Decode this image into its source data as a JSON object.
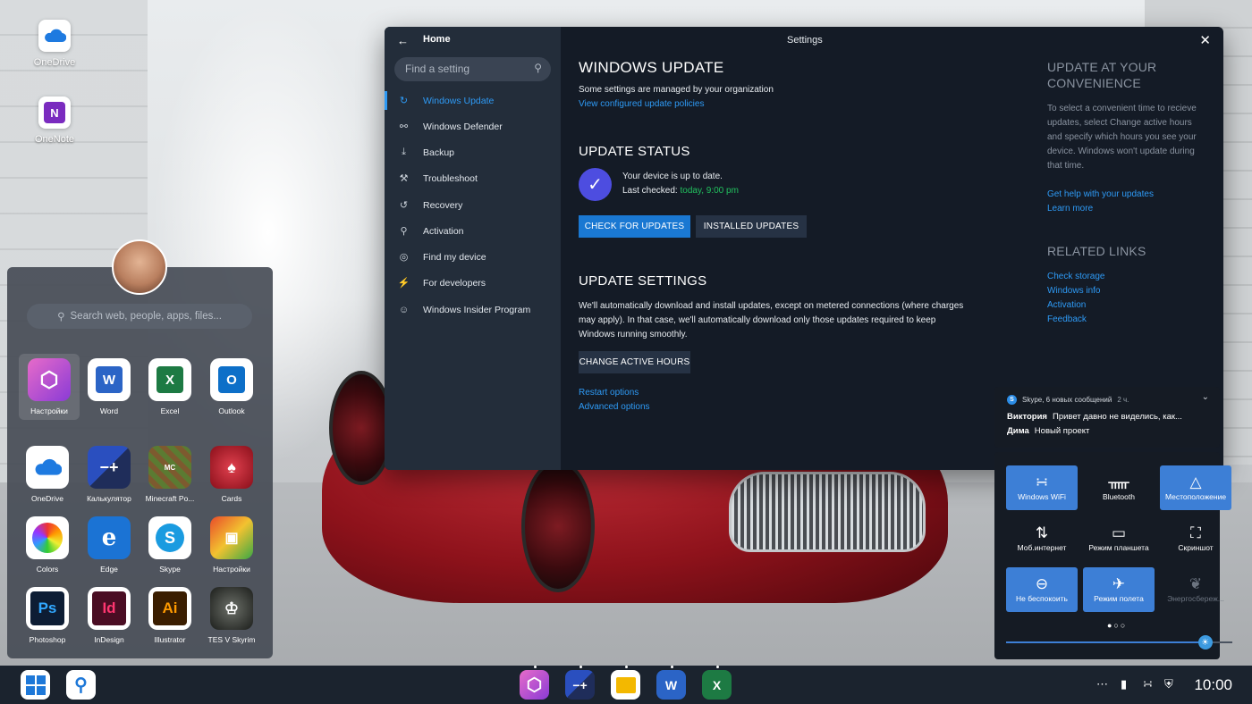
{
  "desktop": {
    "icons": [
      {
        "label": "OneDrive",
        "icon": "onedrive-icon"
      },
      {
        "label": "OneNote",
        "icon": "onenote-icon"
      }
    ]
  },
  "settings": {
    "home_label": "Home",
    "title": "Settings",
    "search_placeholder": "Find a setting",
    "nav": [
      {
        "label": "Windows Update",
        "icon": "refresh-icon",
        "active": true
      },
      {
        "label": "Windows Defender",
        "icon": "shield-icon"
      },
      {
        "label": "Backup",
        "icon": "backup-arrow-icon"
      },
      {
        "label": "Troubleshoot",
        "icon": "wrench-icon"
      },
      {
        "label": "Recovery",
        "icon": "history-icon"
      },
      {
        "label": "Activation",
        "icon": "key-icon"
      },
      {
        "label": "Find my device",
        "icon": "locate-icon"
      },
      {
        "label": "For developers",
        "icon": "developer-icon"
      },
      {
        "label": "Windows Insider Program",
        "icon": "insider-icon"
      }
    ],
    "main": {
      "heading": "WINDOWS UPDATE",
      "managed_note": "Some settings are managed by your organization",
      "policies_link": "View configured update policies",
      "status_heading": "UPDATE STATUS",
      "status_text": "Your device is up to date.",
      "last_checked_label": "Last checked:",
      "last_checked_value": "today, 9:00 pm",
      "check_button": "CHECK FOR UPDATES",
      "installed_button": "INSTALLED UPDATES",
      "settings_heading": "UPDATE SETTINGS",
      "settings_text": "We'll automatically download and install updates, except on metered connections (where charges may apply). In that case, we'll automatically download only those updates required to keep Windows running smoothly.",
      "active_hours_button": "CHANGE ACTIVE HOURS",
      "restart_link": "Restart options",
      "advanced_link": "Advanced options"
    },
    "side": {
      "convenience_heading": "UPDATE AT YOUR CONVENIENCE",
      "convenience_text": "To select a convenient time to recieve updates, select Change active hours and specify which hours you see your device. Windows won't update during that time.",
      "help_link": "Get help with your updates",
      "learn_link": "Learn more",
      "related_heading": "RELATED LINKS",
      "related_links": [
        "Check storage",
        "Windows info",
        "Activation",
        "Feedback"
      ]
    }
  },
  "start_menu": {
    "search_placeholder": "Search web, people, apps, files...",
    "apps": [
      {
        "label": "Настройки",
        "icon": "settings-hex-icon",
        "color": "#c13fa4"
      },
      {
        "label": "Word",
        "icon": "word-icon",
        "color": "#2b64c6"
      },
      {
        "label": "Excel",
        "icon": "excel-icon",
        "color": "#1d7a43"
      },
      {
        "label": "Outlook",
        "icon": "outlook-icon",
        "color": "#0d6fc8"
      },
      {
        "label": "OneDrive",
        "icon": "onedrive-icon",
        "color": "#ffffff"
      },
      {
        "label": "Калькулятор",
        "icon": "calculator-icon",
        "color": "#2a4fbf"
      },
      {
        "label": "Minecraft Po...",
        "icon": "minecraft-icon",
        "color": "#5b7b32"
      },
      {
        "label": "Cards",
        "icon": "cards-icon",
        "color": "#b4192a"
      },
      {
        "label": "Colors",
        "icon": "colors-icon",
        "color": "#7b3fbf"
      },
      {
        "label": "Edge",
        "icon": "edge-icon",
        "color": "#1b73d4"
      },
      {
        "label": "Skype",
        "icon": "skype-icon",
        "color": "#1a9be0"
      },
      {
        "label": "Настройки",
        "icon": "gallery-icon",
        "color": "#d9a21b"
      },
      {
        "label": "Photoshop",
        "icon": "photoshop-icon",
        "color": "#0d1d34"
      },
      {
        "label": "InDesign",
        "icon": "indesign-icon",
        "color": "#4a0d23"
      },
      {
        "label": "Illustrator",
        "icon": "illustrator-icon",
        "color": "#3a1d00"
      },
      {
        "label": "TES V Skyrim",
        "icon": "skyrim-icon",
        "color": "#3b3f3a"
      }
    ]
  },
  "notification": {
    "header": "Skype, 6 новых сообщений",
    "age": "2 ч.",
    "messages": [
      {
        "from": "Виктория",
        "text": "Привет давно не виделись, как..."
      },
      {
        "from": "Дима",
        "text": "Новый проект"
      }
    ]
  },
  "action_center": {
    "tiles": [
      {
        "label": "Windows WiFi",
        "icon": "wifi-icon",
        "on": true
      },
      {
        "label": "Bluetooth",
        "icon": "bluetooth-icon",
        "on": false
      },
      {
        "label": "Местоположение",
        "icon": "location-icon",
        "on": true
      },
      {
        "label": "Моб.интернет",
        "icon": "mobile-data-icon",
        "on": false
      },
      {
        "label": "Режим планшета",
        "icon": "tablet-mode-icon",
        "on": false
      },
      {
        "label": "Скриншот",
        "icon": "screenshot-icon",
        "on": false
      },
      {
        "label": "Не беспокоить",
        "icon": "do-not-disturb-icon",
        "on": true
      },
      {
        "label": "Режим полета",
        "icon": "airplane-icon",
        "on": true
      },
      {
        "label": "Энергосбереж...",
        "icon": "battery-saver-icon",
        "on": false,
        "disabled": true
      }
    ],
    "brightness": 0.88
  },
  "taskbar": {
    "time": "10:00",
    "pinned": [
      "settings-icon",
      "calculator-icon",
      "files-icon",
      "word-icon",
      "excel-icon"
    ]
  },
  "colors": {
    "accent": "#2e9af5",
    "button_primary": "#1a78d2",
    "last_checked": "#22c15e",
    "window_bg": "#141b26",
    "nav_bg": "#232d3a"
  }
}
